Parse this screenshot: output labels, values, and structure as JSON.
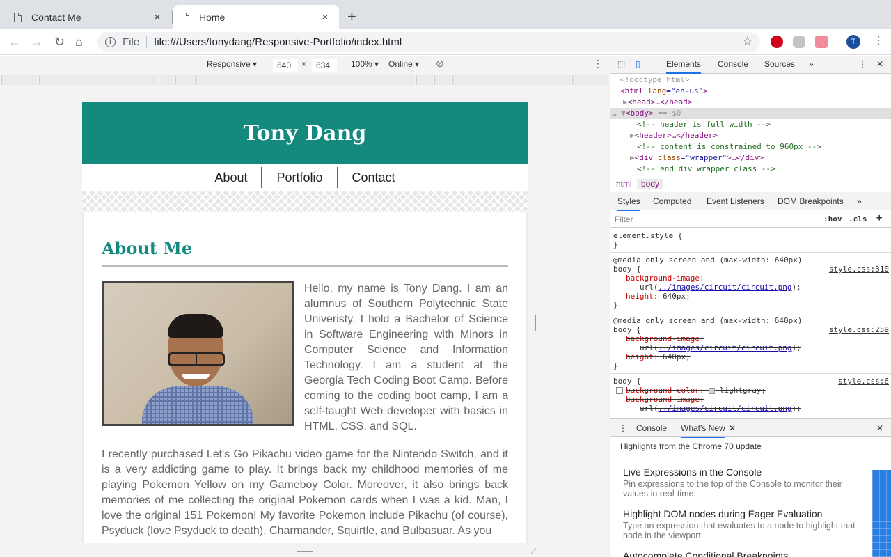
{
  "browser": {
    "tabs": [
      {
        "title": "Contact Me",
        "active": false
      },
      {
        "title": "Home",
        "active": true
      }
    ],
    "scheme_label": "File",
    "url": "file:///Users/tonydang/Responsive-Portfolio/index.html",
    "profile_initial": "T"
  },
  "device_toolbar": {
    "device": "Responsive ▾",
    "width": "640",
    "times": "×",
    "height": "634",
    "zoom": "100% ▾",
    "network": "Online ▾"
  },
  "page": {
    "site_title": "Tony Dang",
    "nav": [
      "About",
      "Portfolio",
      "Contact"
    ],
    "heading": "About Me",
    "para1": "Hello, my name is Tony Dang. I am an alumnus of Southern Polytechnic State Univeristy. I hold a Bachelor of Science in Software Engineering with Minors in Computer Science and Information Technology. I am a student at the Georgia Tech Coding Boot Camp. Before coming to the coding boot camp, I am a self-taught Web developer with basics in HTML, CSS, and SQL.",
    "para2": "I recently purchased Let's Go Pikachu video game for the Nintendo Switch, and it is a very addicting game to play. It brings back my childhood memories of me playing Pokemon Yellow on my Gameboy Color. Moreover, it also brings back memories of me collecting the original Pokemon cards when I was a kid. Man, I love the original 151 Pokemon! My favorite Pokemon include Pikachu (of course), Psyduck (love Psyduck to death), Charmander, Squirtle, and Bulbasuar. As you"
  },
  "devtools": {
    "tabs": [
      "Elements",
      "Console",
      "Sources",
      "»"
    ],
    "dom": {
      "doctype": "<!doctype html>",
      "html_open": "<html",
      "html_attr": " lang",
      "html_val": "=\"en-us\"",
      "html_close": ">",
      "head": "<head>…</head>",
      "body_open": "<body>",
      "body_eq": " == $0",
      "c1": "<!-- header is full width -->",
      "header": "<header>…</header>",
      "c2": "<!-- content is constrained to 960px -->",
      "div_open": "<div",
      "div_attr": " class",
      "div_val": "=\"wrapper\"",
      "div_close": ">…</div>",
      "c3": "<!-- end div wrapper class -->"
    },
    "crumbs": [
      "html",
      "body"
    ],
    "subtabs": [
      "Styles",
      "Computed",
      "Event Listeners",
      "DOM Breakpoints",
      "»"
    ],
    "filter_placeholder": "Filter",
    "hov": ":hov",
    "cls": ".cls",
    "plus": "+",
    "rules": {
      "r0_sel": "element.style {",
      "close": "}",
      "media": "@media only screen and (max-width: 640px)",
      "body_sel": "body {",
      "src1": "style.css:310",
      "src2": "style.css:259",
      "src3": "style.css:6",
      "bg_image": "background-image",
      "url_prefix": "url(",
      "url_link": "../images/circuit/circuit.png",
      "url_suffix": ");",
      "height": "height",
      "height_val": ": 640px;",
      "bg_color": "background-color",
      "lightgray": "lightgray;"
    },
    "drawer": {
      "tabs": [
        "Console",
        "What's New"
      ],
      "highlights": "Highlights from the Chrome 70 update",
      "items": [
        {
          "title": "Live Expressions in the Console",
          "desc": "Pin expressions to the top of the Console to monitor their values in real-time."
        },
        {
          "title": "Highlight DOM nodes during Eager Evaluation",
          "desc": "Type an expression that evaluates to a node to highlight that node in the viewport."
        },
        {
          "title": "Autocomplete Conditional Breakpoints",
          "desc": ""
        }
      ]
    }
  },
  "colors": {
    "brand": "#14897e",
    "accent": "#1a73e8"
  }
}
